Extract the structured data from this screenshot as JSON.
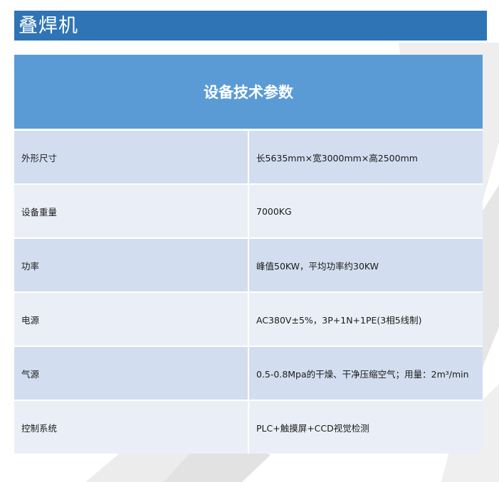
{
  "page": {
    "title": "叠焊机"
  },
  "table": {
    "header": "设备技术参数",
    "rows": [
      {
        "label": "外形尺寸",
        "value": "长5635mm×宽3000mm×高2500mm"
      },
      {
        "label": "设备重量",
        "value": "7000KG"
      },
      {
        "label": "功率",
        "value": "峰值50KW，平均功率约30KW"
      },
      {
        "label": "电源",
        "value": "AC380V±5%，3P+1N+1PE(3相5线制)"
      },
      {
        "label": "气源",
        "value": "0.5-0.8Mpa的干燥、干净压缩空气；用量：2m³/min"
      },
      {
        "label": "控制系统",
        "value": "PLC+触摸屏+CCD视觉检测"
      }
    ]
  },
  "colors": {
    "title_bar": "#2f74b5",
    "table_header": "#5b9bd5",
    "row_dark": "#d2deef",
    "row_light": "#eaeff7"
  }
}
